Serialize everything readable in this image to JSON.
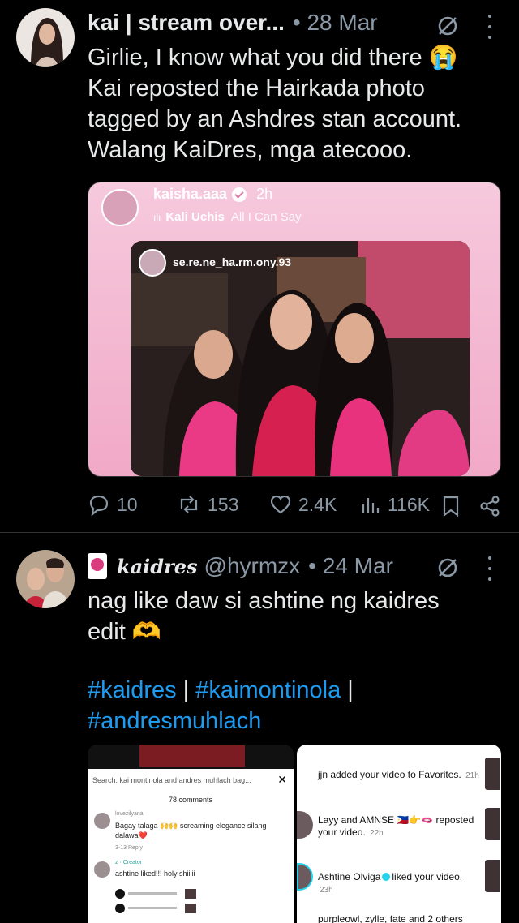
{
  "tweet1": {
    "author_name": "kai | stream over...",
    "date": "28 Mar",
    "text_lines": [
      "Girlie, I know what you did there 😭",
      "Kai reposted the Hairkada photo",
      "tagged by an Ashdres stan account.",
      "Walang KaiDres, mga atecooo."
    ],
    "embed": {
      "username": "kaisha.aaa",
      "time": "2h",
      "song_artist": "Kali Uchis",
      "song_title": "All I Can Say",
      "photo_tag": "se.re.ne_ha.rm.ony.93"
    },
    "stats": {
      "replies": "10",
      "reposts": "153",
      "likes": "2.4K",
      "views": "116K"
    }
  },
  "tweet2": {
    "author_name": "kaidres",
    "handle": "@hyrmzx",
    "date": "• 24 Mar",
    "text_lines": [
      "nag like daw si ashtine ng kaidres",
      "edit 🫶"
    ],
    "hashtags": {
      "tag1": "#kaidres",
      "tag2": "#kaimontinola",
      "tag3": "#andresmuhlach",
      "sep": " | "
    },
    "collage_left": {
      "search": "Search: kai montinola and andres muhlach bag...",
      "comment_count": "78 comments",
      "c1_user": "lovezilyana",
      "c1_text": "Bagay talaga 🙌🙌 screaming elegance silang dalawa❤️",
      "c1_meta": "3-13   Reply",
      "c2_user": "z · Creator",
      "c2_text": "ashtine liked!!! holy shiiiii"
    },
    "collage_right": {
      "r1": "jjn added your video to Favorites.",
      "r1_time": "21h",
      "r2": "Layy and AMNSE 🇵🇭👉🫦 reposted your video.",
      "r2_time": "22h",
      "r3_name": "Ashtine Olviga",
      "r3_text": "liked your video.",
      "r3_time": "23h",
      "r4": "purpleowl, zylle, fate and 2 others"
    }
  },
  "colors": {
    "accent": "#1d9bf0",
    "muted": "#8b98a5",
    "text": "#e7e9ea"
  }
}
